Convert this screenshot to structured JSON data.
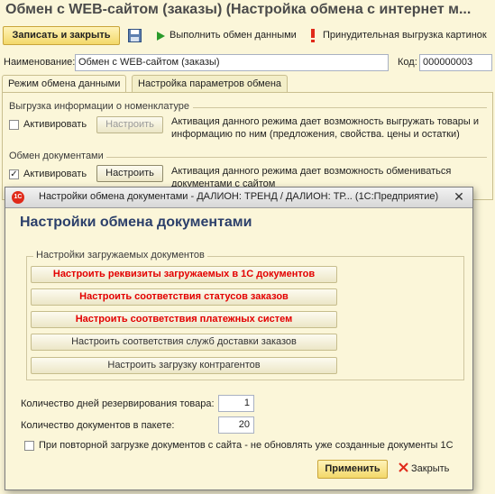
{
  "window": {
    "title": "Обмен с WEB-сайтом (заказы) (Настройка обмена с интернет м..."
  },
  "toolbar": {
    "save_close_label": "Записать и закрыть",
    "save_icon": "floppy-disk-icon",
    "run_exchange_label": "Выполнить обмен данными",
    "run_exchange_icon": "play-icon",
    "force_upload_label": "Принудительная выгрузка картинок",
    "force_upload_icon": "exclamation-icon"
  },
  "form": {
    "name_label": "Наименование:",
    "name_value": "Обмен с WEB-сайтом (заказы)",
    "code_label": "Код:",
    "code_value": "000000003"
  },
  "tabs": [
    {
      "label": "Режим обмена данными",
      "active": true
    },
    {
      "label": "Настройка параметров обмена",
      "active": false
    }
  ],
  "groups": {
    "catalog": {
      "title": "Выгрузка информации о номенклатуре",
      "checkbox_label": "Активировать",
      "checked": false,
      "configure_label": "Настроить",
      "desc_line1": "Активация данного режима дает возможность выгружать товары и",
      "desc_line2": "информацию по ним (предложения, свойства. цены и остатки)"
    },
    "documents": {
      "title": "Обмен документами",
      "checkbox_label": "Активировать",
      "checked": true,
      "configure_label": "Настроить",
      "desc_line1": "Активация данного режима дает возможность обмениваться",
      "desc_line2": "документами с сайтом"
    }
  },
  "dialog": {
    "title": "Настройки обмена документами - ДАЛИОН: ТРЕНД / ДАЛИОН: ТР...  (1С:Предприятие)",
    "app_icon_text": "1С",
    "heading": "Настройки обмена документами",
    "group_title": "Настройки загружаемых документов",
    "buttons": [
      {
        "label": "Настроить реквизиты загружаемых в 1С документов",
        "style": "red"
      },
      {
        "label": "Настроить соответствия статусов заказов",
        "style": "red"
      },
      {
        "label": "Настроить соответствия платежных систем",
        "style": "red"
      },
      {
        "label": "Настроить соответствия служб доставки заказов",
        "style": "normal"
      },
      {
        "label": "Настроить загрузку контрагентов",
        "style": "normal"
      }
    ],
    "reserve_days_label": "Количество дней резервирования товара:",
    "reserve_days_value": "1",
    "docs_per_packet_label": "Количество документов в пакете:",
    "docs_per_packet_value": "20",
    "no_update_label": "При повторной загрузке документов с сайта - не обновлять уже созданные документы 1С",
    "no_update_checked": false,
    "apply_label": "Применить",
    "close_label": "Закрыть",
    "close_icon": "red-x-icon"
  },
  "colors": {
    "background": "#fbf6d9",
    "accent_button": "#f3d86a",
    "red_text": "#e30000",
    "heading": "#2b3f6a"
  }
}
